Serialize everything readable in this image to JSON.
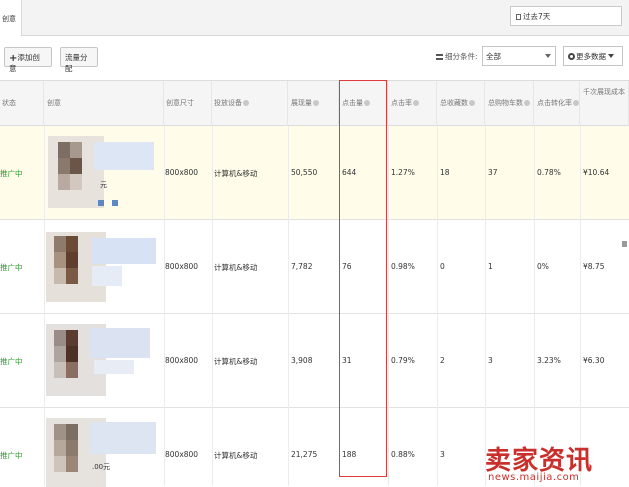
{
  "tabs": {
    "active": "创意"
  },
  "date_range": {
    "value": "过去7天"
  },
  "toolbar": {
    "add_label": "添加创意",
    "flow_label": "流量分配",
    "filter_label": "细分条件:",
    "filter_value": "全部",
    "more_label": "更多数据"
  },
  "table": {
    "headers": {
      "status": "状态",
      "creative": "创意",
      "size": "创意尺寸",
      "device": "投放设备",
      "impressions": "展现量",
      "clicks": "点击量",
      "ctr": "点击率",
      "fav": "总收藏数",
      "cart": "总购物车数",
      "cvr": "点击转化率",
      "cpm": "千次展现成本"
    },
    "rows": [
      {
        "status": "推广中",
        "price": "元",
        "size": "800x800",
        "device": "计算机&移动",
        "impressions": "50,550",
        "clicks": "644",
        "ctr": "1.27%",
        "fav": "18",
        "cart": "37",
        "cvr": "0.78%",
        "cpm": "¥10.64"
      },
      {
        "status": "推广中",
        "price": "",
        "size": "800x800",
        "device": "计算机&移动",
        "impressions": "7,782",
        "clicks": "76",
        "ctr": "0.98%",
        "fav": "0",
        "cart": "1",
        "cvr": "0%",
        "cpm": "¥8.75"
      },
      {
        "status": "推广中",
        "price": "",
        "size": "800x800",
        "device": "计算机&移动",
        "impressions": "3,908",
        "clicks": "31",
        "ctr": "0.79%",
        "fav": "2",
        "cart": "3",
        "cvr": "3.23%",
        "cpm": "¥6.30"
      },
      {
        "status": "推广中",
        "price": ".00元",
        "size": "800x800",
        "device": "计算机&移动",
        "impressions": "21,275",
        "clicks": "188",
        "ctr": "0.88%",
        "fav": "3",
        "cart": "",
        "cvr": "",
        "cpm": ""
      }
    ]
  },
  "watermark": {
    "cn": "卖家资讯",
    "en": "news.maijia.com"
  },
  "colors": {
    "status": "#2a9a2a",
    "highlight_box": "#e03b3b",
    "watermark": "#c9302c",
    "row_highlight": "#fffde9"
  }
}
